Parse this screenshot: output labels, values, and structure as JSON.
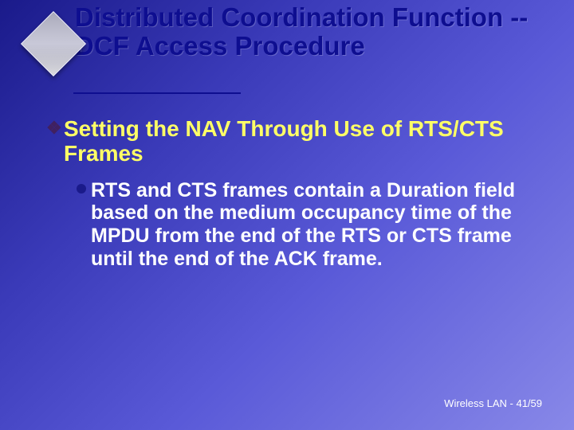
{
  "slide": {
    "title": "Distributed Coordination Function -- DCF Access Procedure",
    "bullets": {
      "lvl1_text": "Setting the NAV Through Use of RTS/CTS Frames",
      "lvl2_text": "RTS and CTS frames contain a Duration field based on the medium occupancy time of the MPDU from the end of the RTS or CTS frame until the end of the ACK frame."
    },
    "footer": "Wireless LAN - 41/59"
  }
}
